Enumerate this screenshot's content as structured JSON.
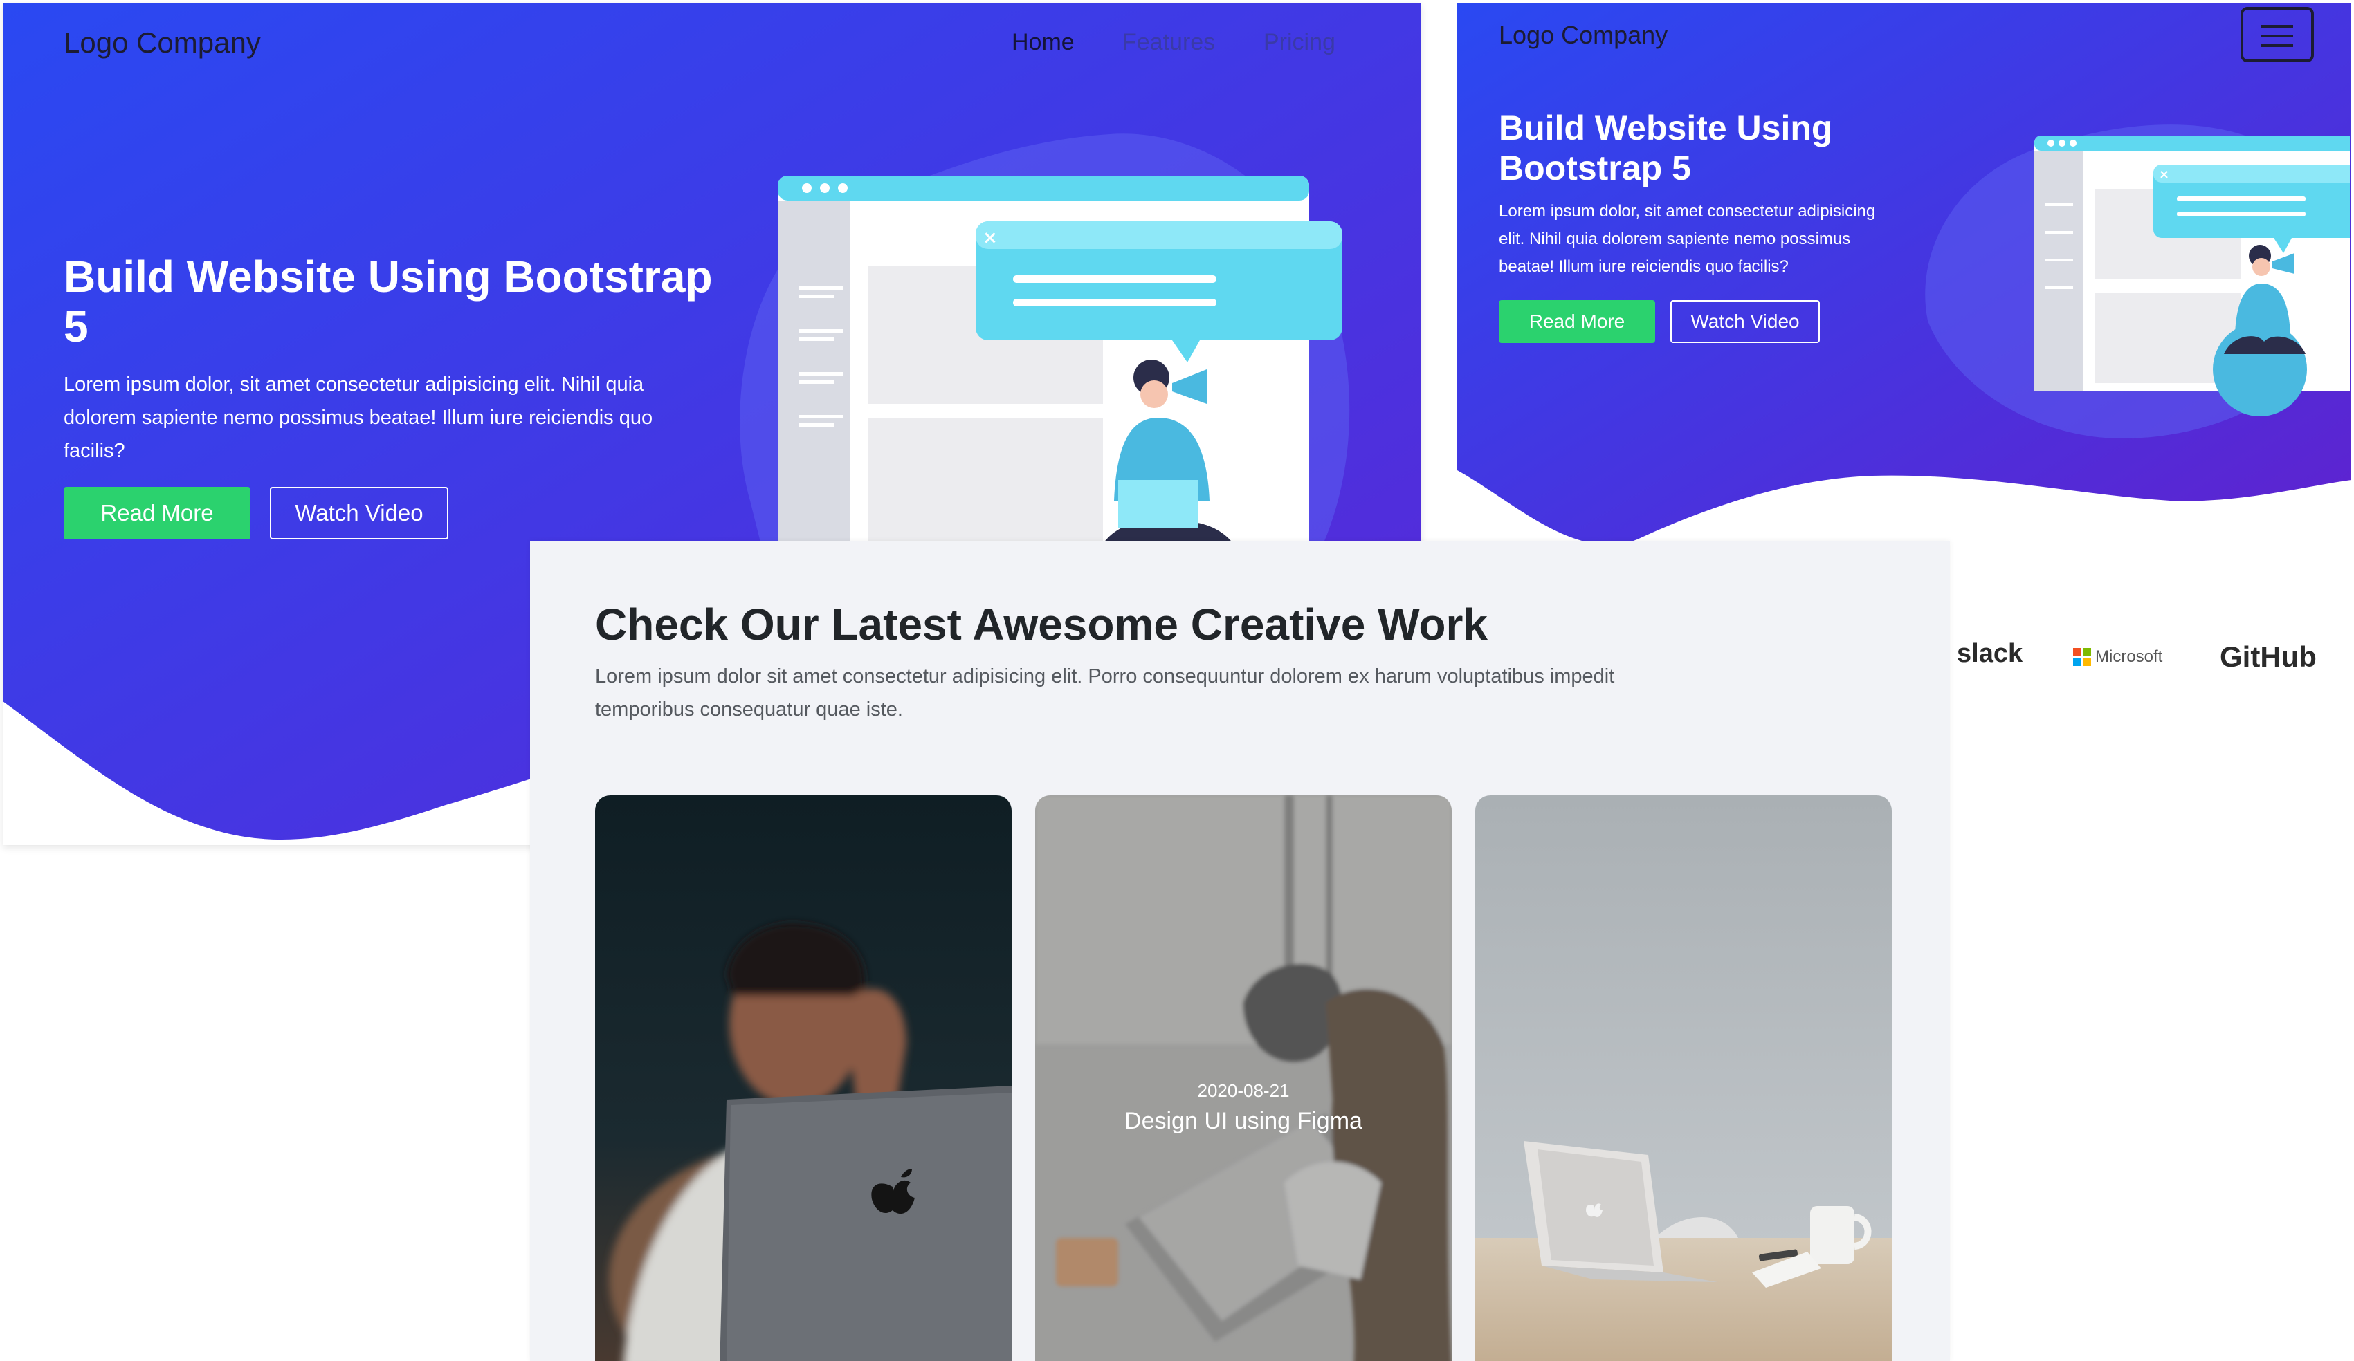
{
  "desktop": {
    "logo": "Logo Company",
    "nav": [
      "Home",
      "Features",
      "Pricing"
    ],
    "title": "Build Website Using Bootstrap 5",
    "description": "Lorem ipsum dolor, sit amet consectetur adipisicing elit. Nihil quia dolorem sapiente nemo possimus beatae! Illum iure reiciendis quo facilis?",
    "read_more": "Read More",
    "watch_video": "Watch Video"
  },
  "mobile": {
    "logo": "Logo Company",
    "title": "Build Website Using Bootstrap 5",
    "description": "Lorem ipsum dolor, sit amet consectetur adipisicing elit. Nihil quia dolorem sapiente nemo possimus beatae! Illum iure reiciendis quo facilis?",
    "read_more": "Read More",
    "watch_video": "Watch Video",
    "menu_icon": "hamburger-menu-icon",
    "brands": [
      "slack",
      "Microsoft",
      "GitHub"
    ]
  },
  "portfolio": {
    "heading": "Check Our Latest Awesome Creative Work",
    "lead": "Lorem ipsum dolor sit amet consectetur adipisicing elit. Porro consequuntur dolorem ex harum voluptatibus impedit temporibus consequatur quae iste.",
    "cards": [
      {
        "date": "",
        "title": ""
      },
      {
        "date": "2020-08-21",
        "title": "Design UI using Figma"
      },
      {
        "date": "",
        "title": ""
      }
    ]
  },
  "colors": {
    "hero_gradient_start": "#2b44f0",
    "hero_gradient_end": "#5a28d8",
    "accent_green": "#2bd26e",
    "illustration_cyan": "#5fd8f0",
    "section_bg": "#f2f3f7"
  }
}
